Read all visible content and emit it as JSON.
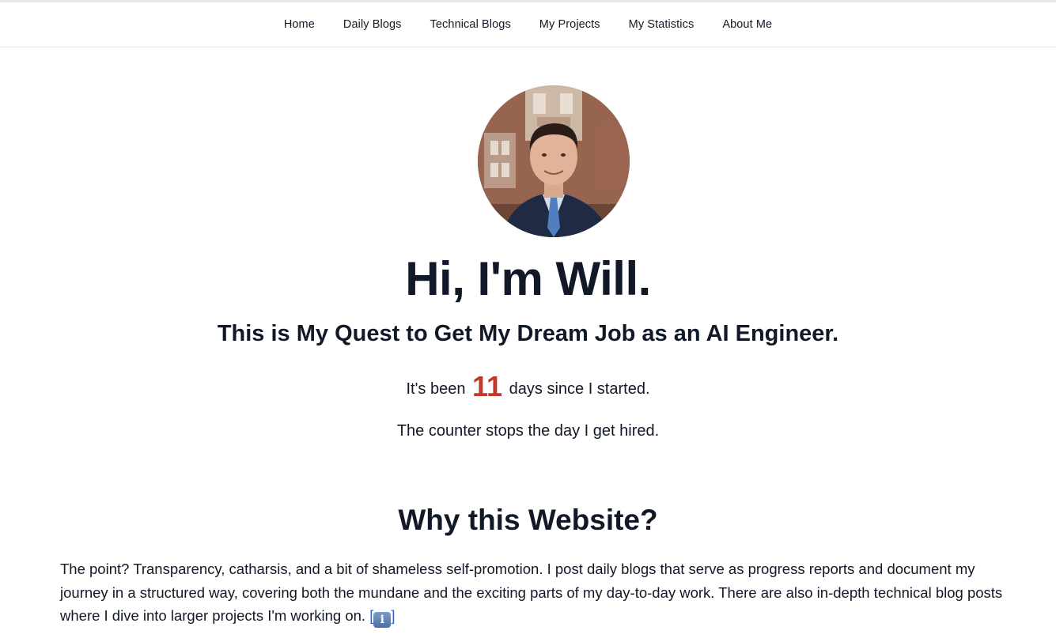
{
  "nav": {
    "items": [
      {
        "label": "Home"
      },
      {
        "label": "Daily Blogs"
      },
      {
        "label": "Technical Blogs"
      },
      {
        "label": "My Projects"
      },
      {
        "label": "My Statistics"
      },
      {
        "label": "About Me"
      }
    ]
  },
  "hero": {
    "title": "Hi, I'm Will.",
    "subtitle": "This is My Quest to Get My Dream Job as an AI Engineer.",
    "counter_prefix": "It's been",
    "counter_value": "11",
    "counter_suffix": "days since I started.",
    "stop_note": "The counter stops the day I get hired."
  },
  "why": {
    "title": "Why this Website?",
    "body": "The point? Transparency, catharsis, and a bit of shameless self-promotion. I post daily blogs that serve as progress reports and document my journey in a structured way, covering both the mundane and the exciting parts of my day-to-day work. There are also in-depth technical blog posts where I dive into larger projects I'm working on.",
    "info_link_open": "[",
    "info_icon_glyph": "i",
    "info_link_close": "]"
  },
  "colors": {
    "text": "#111827",
    "counter_accent": "#c0392b",
    "link": "#2563eb",
    "border": "#e5e7eb"
  },
  "icons": {
    "info": "information-icon",
    "avatar": "profile-photo"
  }
}
